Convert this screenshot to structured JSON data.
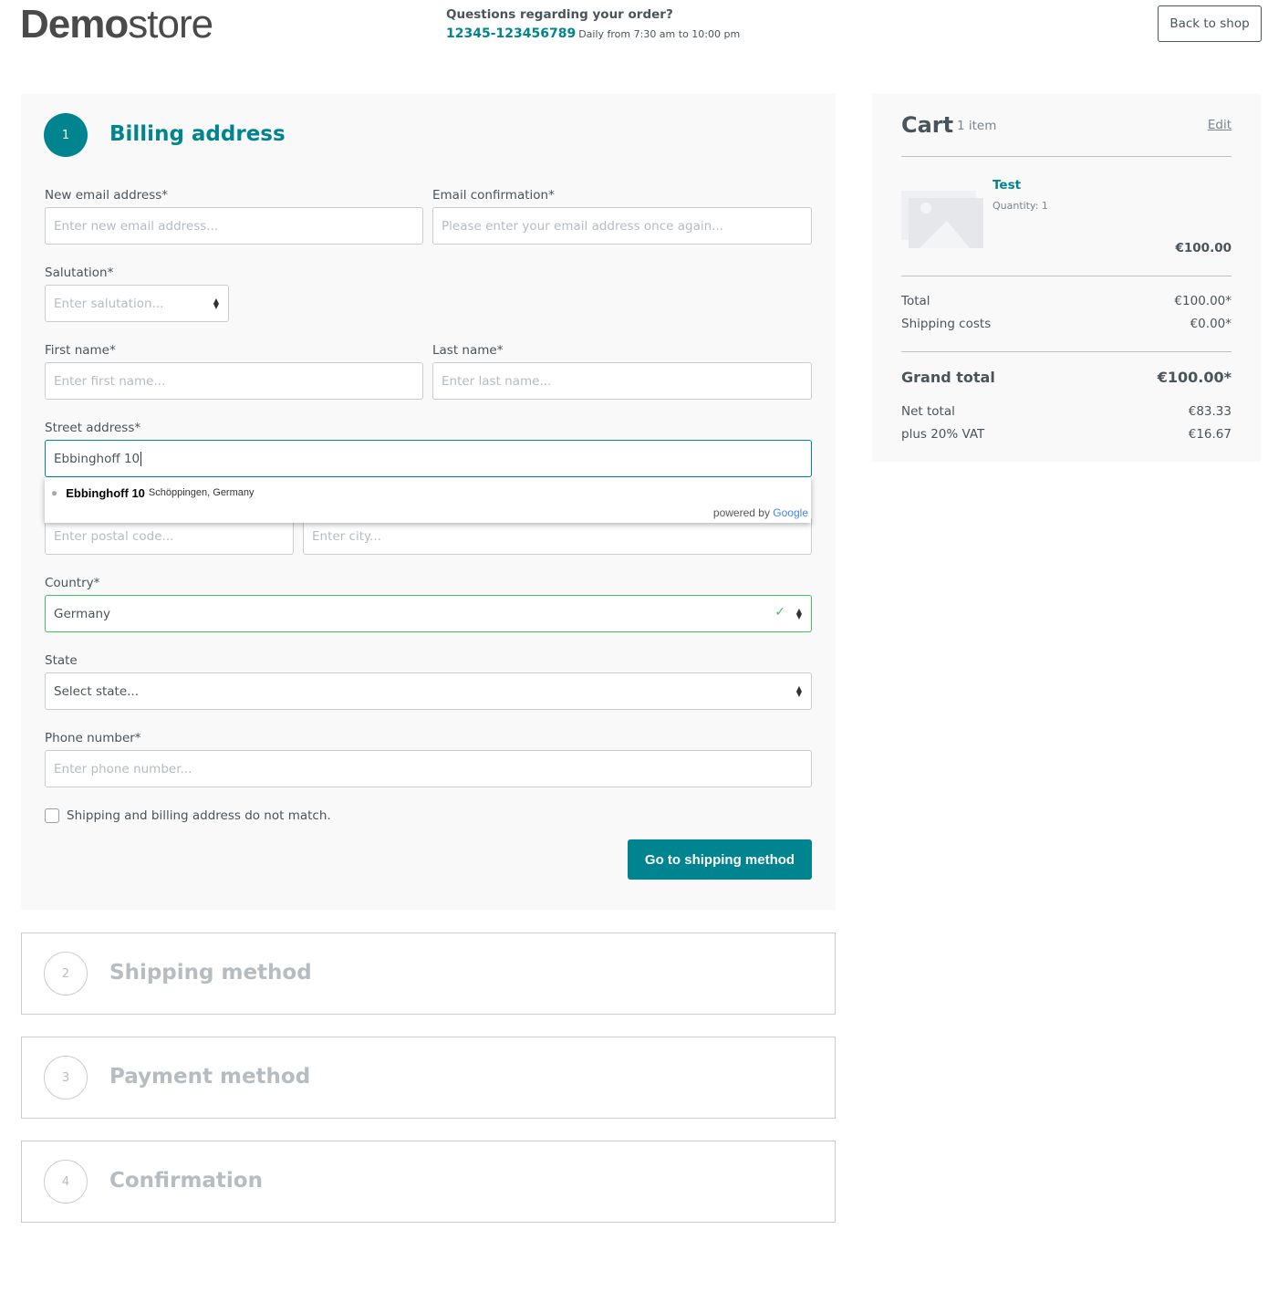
{
  "header": {
    "logo_bold": "Demo",
    "logo_light": "store",
    "question": "Questions regarding your order?",
    "phone": "12345-123456789",
    "hours": "Daily from 7:30 am to 10:00 pm",
    "back_label": "Back to shop"
  },
  "billing": {
    "step": "1",
    "title": "Billing address",
    "email_label": "New email address*",
    "email_placeholder": "Enter new email address...",
    "email_conf_label": "Email confirmation*",
    "email_conf_placeholder": "Please enter your email address once again...",
    "salutation_label": "Salutation*",
    "salutation_placeholder": "Enter salutation...",
    "first_label": "First name*",
    "first_placeholder": "Enter first name...",
    "last_label": "Last name*",
    "last_placeholder": "Enter last name...",
    "street_label": "Street address*",
    "street_value": "Ebbinghoff 10",
    "suggestion_main": "Ebbinghoff 10",
    "suggestion_secondary": "Schöppingen, Germany",
    "powered_by": "powered by",
    "google": "Google",
    "postal_placeholder": "Enter postal code...",
    "city_placeholder": "Enter city...",
    "country_label": "Country*",
    "country_value": "Germany",
    "state_label": "State",
    "state_value": "Select state...",
    "phone_label": "Phone number*",
    "phone_placeholder": "Enter phone number...",
    "checkbox_label": "Shipping and billing address do not match.",
    "checkbox_checked": false,
    "submit_label": "Go to shipping method"
  },
  "steps": [
    {
      "num": "2",
      "title": "Shipping method"
    },
    {
      "num": "3",
      "title": "Payment method"
    },
    {
      "num": "4",
      "title": "Confirmation"
    }
  ],
  "cart": {
    "title": "Cart",
    "count": "1 item",
    "edit": "Edit",
    "item": {
      "name": "Test",
      "quantity": "Quantity: 1",
      "price": "€100.00"
    },
    "total_label": "Total",
    "total": "€100.00*",
    "shipping_label": "Shipping costs",
    "shipping": "€0.00*",
    "grand_label": "Grand total",
    "grand": "€100.00*",
    "net_label": "Net total",
    "net": "€83.33",
    "vat_label": "plus 20% VAT",
    "vat": "€16.67"
  },
  "colors": {
    "accent": "#008490",
    "valid": "#3cc261",
    "panel_bg": "#f9f9f9"
  }
}
